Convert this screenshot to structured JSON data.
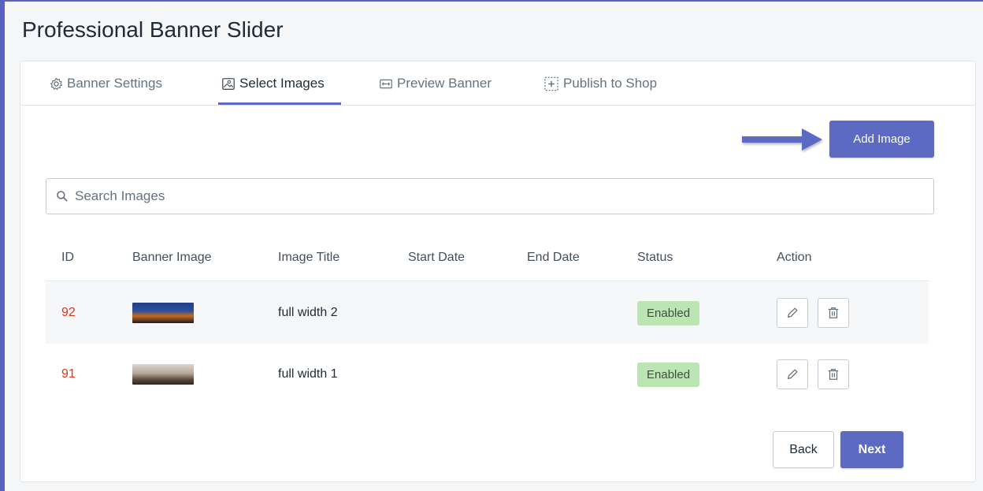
{
  "page": {
    "title": "Professional Banner Slider"
  },
  "tabs": [
    {
      "label": "Banner Settings",
      "icon": "gear-icon"
    },
    {
      "label": "Select Images",
      "icon": "image-icon",
      "active": true
    },
    {
      "label": "Preview Banner",
      "icon": "expand-horizontal-icon"
    },
    {
      "label": "Publish to Shop",
      "icon": "add-frame-icon"
    }
  ],
  "toolbar": {
    "add_label": "Add Image"
  },
  "search": {
    "placeholder": "Search Images",
    "value": ""
  },
  "table": {
    "columns": [
      "ID",
      "Banner Image",
      "Image Title",
      "Start Date",
      "End Date",
      "Status",
      "Action"
    ],
    "rows": [
      {
        "id": "92",
        "thumbnail": "city-night-skyline",
        "title": "full width 2",
        "start_date": "",
        "end_date": "",
        "status": "Enabled"
      },
      {
        "id": "91",
        "thumbnail": "city-day-skyline",
        "title": "full width 1",
        "start_date": "",
        "end_date": "",
        "status": "Enabled"
      }
    ]
  },
  "footer": {
    "back_label": "Back",
    "next_label": "Next"
  },
  "colors": {
    "accent": "#5c6ac4",
    "frame": "#5a63c4",
    "id_text": "#de3618",
    "enabled_badge": "#bbe5b3"
  }
}
